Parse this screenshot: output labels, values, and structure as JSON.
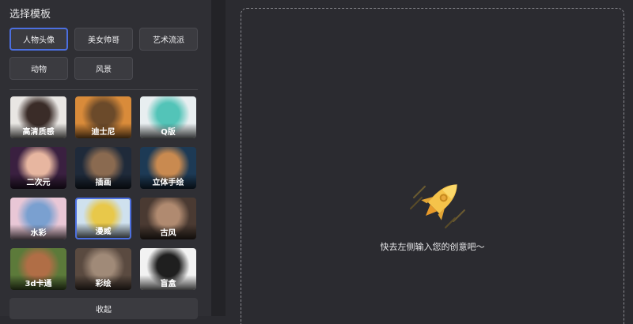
{
  "sidebar": {
    "section_title": "选择模板",
    "categories": [
      {
        "label": "人物头像",
        "active": true
      },
      {
        "label": "美女帅哥",
        "active": false
      },
      {
        "label": "艺术流派",
        "active": false
      },
      {
        "label": "动物",
        "active": false
      },
      {
        "label": "风景",
        "active": false
      }
    ],
    "templates": [
      {
        "label": "高清质感",
        "selected": false,
        "colors": [
          "#e9e6e3",
          "#3a2c28"
        ]
      },
      {
        "label": "迪士尼",
        "selected": false,
        "colors": [
          "#d98b3a",
          "#6b4a2a"
        ]
      },
      {
        "label": "Q版",
        "selected": false,
        "colors": [
          "#e8eef0",
          "#53c4b8"
        ]
      },
      {
        "label": "二次元",
        "selected": false,
        "colors": [
          "#3a2040",
          "#e7b6a0"
        ]
      },
      {
        "label": "插画",
        "selected": false,
        "colors": [
          "#1f2a3a",
          "#8a6a50"
        ]
      },
      {
        "label": "立体手绘",
        "selected": false,
        "colors": [
          "#1d3a55",
          "#c98a50"
        ]
      },
      {
        "label": "水彩",
        "selected": false,
        "colors": [
          "#e9c7d6",
          "#7aa0d0"
        ]
      },
      {
        "label": "漫威",
        "selected": true,
        "colors": [
          "#cfe1ee",
          "#e8c84a"
        ]
      },
      {
        "label": "古风",
        "selected": false,
        "colors": [
          "#4a3a32",
          "#b08a70"
        ]
      },
      {
        "label": "3d卡通",
        "selected": false,
        "colors": [
          "#5c7a3a",
          "#b06e46"
        ]
      },
      {
        "label": "彩绘",
        "selected": false,
        "colors": [
          "#5a4a40",
          "#a08a78"
        ]
      },
      {
        "label": "盲盒",
        "selected": false,
        "colors": [
          "#f2f2f2",
          "#1f1f1f"
        ]
      }
    ],
    "collapse_label": "收起"
  },
  "main": {
    "empty_message": "快去左侧输入您的创意吧～",
    "rocket_icon": "rocket-icon",
    "accent_color": "#4c6fe0"
  }
}
